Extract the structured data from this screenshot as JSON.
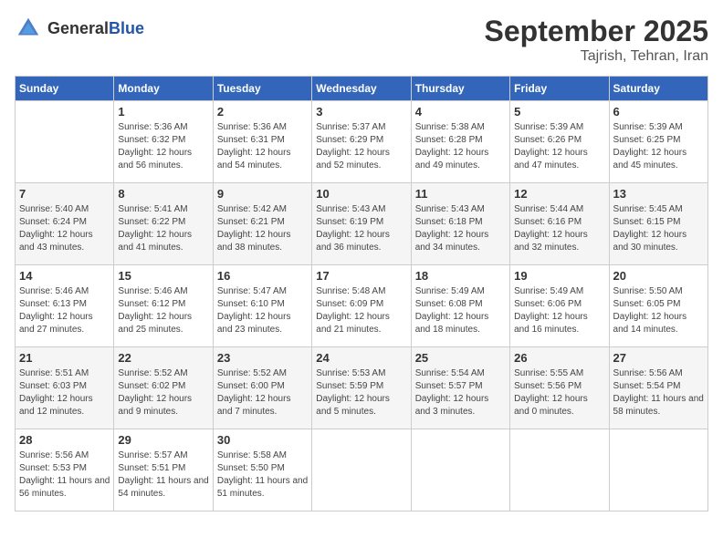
{
  "header": {
    "logo_general": "General",
    "logo_blue": "Blue",
    "month": "September 2025",
    "location": "Tajrish, Tehran, Iran"
  },
  "days_of_week": [
    "Sunday",
    "Monday",
    "Tuesday",
    "Wednesday",
    "Thursday",
    "Friday",
    "Saturday"
  ],
  "weeks": [
    [
      {
        "day": "",
        "sunrise": "",
        "sunset": "",
        "daylight": ""
      },
      {
        "day": "1",
        "sunrise": "Sunrise: 5:36 AM",
        "sunset": "Sunset: 6:32 PM",
        "daylight": "Daylight: 12 hours and 56 minutes."
      },
      {
        "day": "2",
        "sunrise": "Sunrise: 5:36 AM",
        "sunset": "Sunset: 6:31 PM",
        "daylight": "Daylight: 12 hours and 54 minutes."
      },
      {
        "day": "3",
        "sunrise": "Sunrise: 5:37 AM",
        "sunset": "Sunset: 6:29 PM",
        "daylight": "Daylight: 12 hours and 52 minutes."
      },
      {
        "day": "4",
        "sunrise": "Sunrise: 5:38 AM",
        "sunset": "Sunset: 6:28 PM",
        "daylight": "Daylight: 12 hours and 49 minutes."
      },
      {
        "day": "5",
        "sunrise": "Sunrise: 5:39 AM",
        "sunset": "Sunset: 6:26 PM",
        "daylight": "Daylight: 12 hours and 47 minutes."
      },
      {
        "day": "6",
        "sunrise": "Sunrise: 5:39 AM",
        "sunset": "Sunset: 6:25 PM",
        "daylight": "Daylight: 12 hours and 45 minutes."
      }
    ],
    [
      {
        "day": "7",
        "sunrise": "Sunrise: 5:40 AM",
        "sunset": "Sunset: 6:24 PM",
        "daylight": "Daylight: 12 hours and 43 minutes."
      },
      {
        "day": "8",
        "sunrise": "Sunrise: 5:41 AM",
        "sunset": "Sunset: 6:22 PM",
        "daylight": "Daylight: 12 hours and 41 minutes."
      },
      {
        "day": "9",
        "sunrise": "Sunrise: 5:42 AM",
        "sunset": "Sunset: 6:21 PM",
        "daylight": "Daylight: 12 hours and 38 minutes."
      },
      {
        "day": "10",
        "sunrise": "Sunrise: 5:43 AM",
        "sunset": "Sunset: 6:19 PM",
        "daylight": "Daylight: 12 hours and 36 minutes."
      },
      {
        "day": "11",
        "sunrise": "Sunrise: 5:43 AM",
        "sunset": "Sunset: 6:18 PM",
        "daylight": "Daylight: 12 hours and 34 minutes."
      },
      {
        "day": "12",
        "sunrise": "Sunrise: 5:44 AM",
        "sunset": "Sunset: 6:16 PM",
        "daylight": "Daylight: 12 hours and 32 minutes."
      },
      {
        "day": "13",
        "sunrise": "Sunrise: 5:45 AM",
        "sunset": "Sunset: 6:15 PM",
        "daylight": "Daylight: 12 hours and 30 minutes."
      }
    ],
    [
      {
        "day": "14",
        "sunrise": "Sunrise: 5:46 AM",
        "sunset": "Sunset: 6:13 PM",
        "daylight": "Daylight: 12 hours and 27 minutes."
      },
      {
        "day": "15",
        "sunrise": "Sunrise: 5:46 AM",
        "sunset": "Sunset: 6:12 PM",
        "daylight": "Daylight: 12 hours and 25 minutes."
      },
      {
        "day": "16",
        "sunrise": "Sunrise: 5:47 AM",
        "sunset": "Sunset: 6:10 PM",
        "daylight": "Daylight: 12 hours and 23 minutes."
      },
      {
        "day": "17",
        "sunrise": "Sunrise: 5:48 AM",
        "sunset": "Sunset: 6:09 PM",
        "daylight": "Daylight: 12 hours and 21 minutes."
      },
      {
        "day": "18",
        "sunrise": "Sunrise: 5:49 AM",
        "sunset": "Sunset: 6:08 PM",
        "daylight": "Daylight: 12 hours and 18 minutes."
      },
      {
        "day": "19",
        "sunrise": "Sunrise: 5:49 AM",
        "sunset": "Sunset: 6:06 PM",
        "daylight": "Daylight: 12 hours and 16 minutes."
      },
      {
        "day": "20",
        "sunrise": "Sunrise: 5:50 AM",
        "sunset": "Sunset: 6:05 PM",
        "daylight": "Daylight: 12 hours and 14 minutes."
      }
    ],
    [
      {
        "day": "21",
        "sunrise": "Sunrise: 5:51 AM",
        "sunset": "Sunset: 6:03 PM",
        "daylight": "Daylight: 12 hours and 12 minutes."
      },
      {
        "day": "22",
        "sunrise": "Sunrise: 5:52 AM",
        "sunset": "Sunset: 6:02 PM",
        "daylight": "Daylight: 12 hours and 9 minutes."
      },
      {
        "day": "23",
        "sunrise": "Sunrise: 5:52 AM",
        "sunset": "Sunset: 6:00 PM",
        "daylight": "Daylight: 12 hours and 7 minutes."
      },
      {
        "day": "24",
        "sunrise": "Sunrise: 5:53 AM",
        "sunset": "Sunset: 5:59 PM",
        "daylight": "Daylight: 12 hours and 5 minutes."
      },
      {
        "day": "25",
        "sunrise": "Sunrise: 5:54 AM",
        "sunset": "Sunset: 5:57 PM",
        "daylight": "Daylight: 12 hours and 3 minutes."
      },
      {
        "day": "26",
        "sunrise": "Sunrise: 5:55 AM",
        "sunset": "Sunset: 5:56 PM",
        "daylight": "Daylight: 12 hours and 0 minutes."
      },
      {
        "day": "27",
        "sunrise": "Sunrise: 5:56 AM",
        "sunset": "Sunset: 5:54 PM",
        "daylight": "Daylight: 11 hours and 58 minutes."
      }
    ],
    [
      {
        "day": "28",
        "sunrise": "Sunrise: 5:56 AM",
        "sunset": "Sunset: 5:53 PM",
        "daylight": "Daylight: 11 hours and 56 minutes."
      },
      {
        "day": "29",
        "sunrise": "Sunrise: 5:57 AM",
        "sunset": "Sunset: 5:51 PM",
        "daylight": "Daylight: 11 hours and 54 minutes."
      },
      {
        "day": "30",
        "sunrise": "Sunrise: 5:58 AM",
        "sunset": "Sunset: 5:50 PM",
        "daylight": "Daylight: 11 hours and 51 minutes."
      },
      {
        "day": "",
        "sunrise": "",
        "sunset": "",
        "daylight": ""
      },
      {
        "day": "",
        "sunrise": "",
        "sunset": "",
        "daylight": ""
      },
      {
        "day": "",
        "sunrise": "",
        "sunset": "",
        "daylight": ""
      },
      {
        "day": "",
        "sunrise": "",
        "sunset": "",
        "daylight": ""
      }
    ]
  ]
}
